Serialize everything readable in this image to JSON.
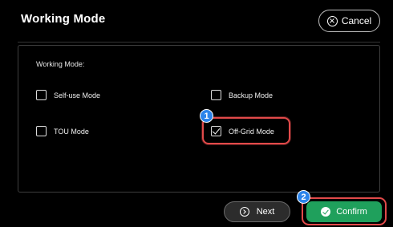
{
  "dialog": {
    "title": "Working Mode",
    "cancel_label": "Cancel"
  },
  "panel": {
    "label": "Working Mode:",
    "options": [
      {
        "label": "Self-use Mode",
        "checked": false
      },
      {
        "label": "Backup Mode",
        "checked": false
      },
      {
        "label": "TOU Mode",
        "checked": false
      },
      {
        "label": "Off-Grid Mode",
        "checked": true
      }
    ]
  },
  "footer": {
    "next_label": "Next",
    "confirm_label": "Confirm"
  },
  "annotations": {
    "step1": "1",
    "step2": "2",
    "highlight_color": "#e24a4a",
    "badge_color": "#2b84ea"
  },
  "colors": {
    "confirm": "#1fa05c",
    "background": "#000000"
  }
}
